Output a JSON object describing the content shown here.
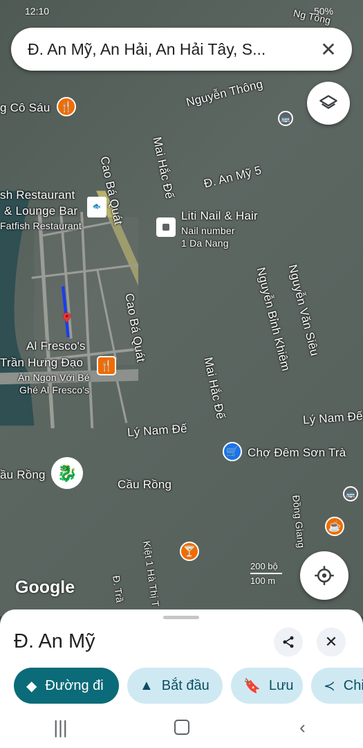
{
  "status_bar": {
    "left_text": "12:10",
    "right_text": "50%"
  },
  "search": {
    "query": "Đ. An Mỹ, An Hải, An Hải Tây, S...",
    "close_icon": "close-icon"
  },
  "map": {
    "labels": {
      "nguyen_thong": "Nguyễn Thông",
      "mai_hac_de_top": "Mai Hắc Đế",
      "an_my_5": "Đ. An Mỹ 5",
      "cao_ba_quat_top": "Cao Bá Quát",
      "cao_ba_quat_mid": "Cao Bá Quát",
      "nguyen_binh_khiem": "Nguyễn Bỉnh Khiêm",
      "nguyen_van_sieu": "Nguyễn Văn Siêu",
      "mai_hac_de_bottom": "Mai Hắc Đế",
      "ly_nam_de_left": "Lý Nam Đế",
      "ly_nam_de_right": "Lý Nam Đế",
      "cau_rong": "Cầu Rồng",
      "dong_giang": "Đồng Giang",
      "kiet_ha_thi": "Kiệt 1 Hà Thị T",
      "tran": "Đ. Trầ",
      "n_tong": "Ng Tông"
    },
    "pois": {
      "co_sau": "g Cô Sáu",
      "fatfish_name_1": "sh Restaurant",
      "fatfish_name_2": "& Lounge Bar",
      "fatfish_sub": "Fatfish Restaurant",
      "liti_name": "Liti Nail & Hair",
      "liti_sub_1": "Nail number",
      "liti_sub_2": "1 Da Nang",
      "alfresco_1": "Al Fresco's",
      "alfresco_2": "Trần Hưng Đạo",
      "alfresco_3": "Ăn Ngon Với Bé",
      "alfresco_4": "Ghé Al Fresco's",
      "cho_dem": "Chợ Đêm Sơn Trà",
      "cau_rong_poi": "ầu Rồng"
    },
    "scale": {
      "meters": "200 bộ",
      "feet": "100 m"
    },
    "logo": "Google"
  },
  "sheet": {
    "title": "Đ. An Mỹ",
    "actions": [
      {
        "label": "Đường đi",
        "icon": "directions-icon"
      },
      {
        "label": "Bắt đầu",
        "icon": "navigation-icon"
      },
      {
        "label": "Lưu",
        "icon": "bookmark-icon"
      },
      {
        "label": "Chi",
        "icon": "share-icon"
      }
    ]
  },
  "colors": {
    "route": "#1a3cf0",
    "pin": "#e53935",
    "primary_chip": "#0b6b78",
    "secondary_chip": "#cfe9f3"
  }
}
